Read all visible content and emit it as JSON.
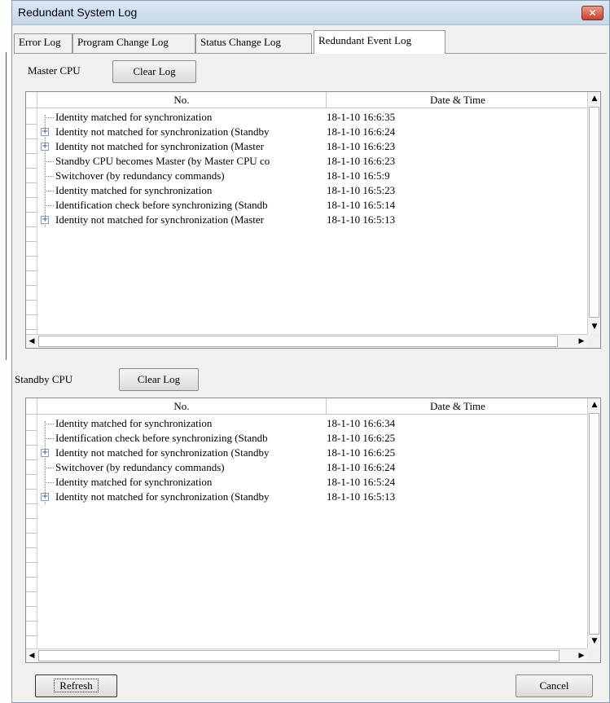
{
  "window": {
    "title": "Redundant System Log",
    "close_label": "✕"
  },
  "tabs": [
    {
      "label": "Error Log"
    },
    {
      "label": "Program Change Log"
    },
    {
      "label": "Status Change Log"
    },
    {
      "label": "Redundant Event Log",
      "active": true
    }
  ],
  "master": {
    "label": "Master CPU",
    "clear_label": "Clear Log",
    "columns": {
      "no": "No.",
      "datetime": "Date & Time"
    },
    "rows": [
      {
        "expandable": false,
        "event": "Identity matched for synchronization",
        "datetime": "18-1-10  16:6:35"
      },
      {
        "expandable": true,
        "event": "Identity not matched for synchronization (Standby",
        "datetime": "18-1-10  16:6:24"
      },
      {
        "expandable": true,
        "event": "Identity not matched for synchronization (Master",
        "datetime": "18-1-10  16:6:23"
      },
      {
        "expandable": false,
        "event": "Standby CPU becomes Master (by Master CPU co",
        "datetime": "18-1-10  16:6:23"
      },
      {
        "expandable": false,
        "event": "Switchover (by redundancy commands)",
        "datetime": "18-1-10  16:5:9"
      },
      {
        "expandable": false,
        "event": "Identity matched for synchronization",
        "datetime": "18-1-10  16:5:23"
      },
      {
        "expandable": false,
        "event": "Identification check before synchronizing (Standb",
        "datetime": "18-1-10  16:5:14"
      },
      {
        "expandable": true,
        "event": "Identity not matched for synchronization (Master",
        "datetime": "18-1-10  16:5:13"
      }
    ]
  },
  "standby": {
    "label": "Standby CPU",
    "clear_label": "Clear Log",
    "columns": {
      "no": "No.",
      "datetime": "Date & Time"
    },
    "rows": [
      {
        "expandable": false,
        "event": "Identity matched for synchronization",
        "datetime": "18-1-10  16:6:34"
      },
      {
        "expandable": false,
        "event": "Identification check before synchronizing (Standb",
        "datetime": "18-1-10  16:6:25"
      },
      {
        "expandable": true,
        "event": "Identity not matched for synchronization (Standby",
        "datetime": "18-1-10  16:6:25"
      },
      {
        "expandable": false,
        "event": "Switchover (by redundancy commands)",
        "datetime": "18-1-10  16:6:24"
      },
      {
        "expandable": false,
        "event": "Identity matched for synchronization",
        "datetime": "18-1-10  16:5:24"
      },
      {
        "expandable": true,
        "event": "Identity not matched for synchronization (Standby",
        "datetime": "18-1-10  16:5:13"
      }
    ]
  },
  "footer": {
    "refresh_label": "Refresh",
    "cancel_label": "Cancel"
  },
  "icons": {
    "expander": "+",
    "scroll_up": "▲",
    "scroll_down": "▼",
    "scroll_left": "◀",
    "scroll_right": "▶"
  }
}
